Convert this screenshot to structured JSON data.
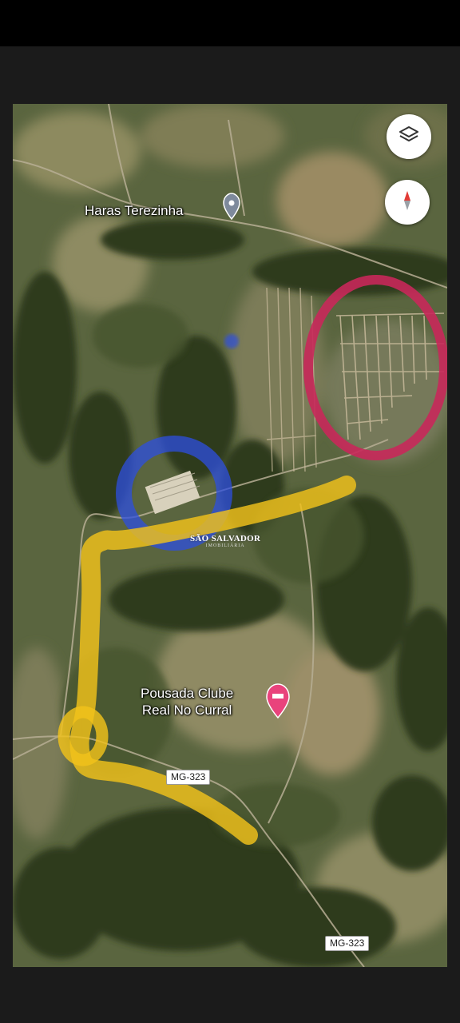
{
  "map": {
    "places": {
      "haras": "Haras Terezinha",
      "pousada": "Pousada Clube\nReal No Curral"
    },
    "roads": {
      "shield_1": "MG-323",
      "shield_2": "MG-323"
    },
    "watermark": {
      "title": "SÃO SALVADOR",
      "subtitle": "IMOBILIÁRIA"
    },
    "controls": {
      "layers_icon": "layers-icon",
      "compass_icon": "compass-icon"
    },
    "highlight_colors": {
      "red_circle": "#c8285a",
      "blue_circle": "#2e4fe0",
      "yellow_route": "#f1c21b"
    }
  }
}
